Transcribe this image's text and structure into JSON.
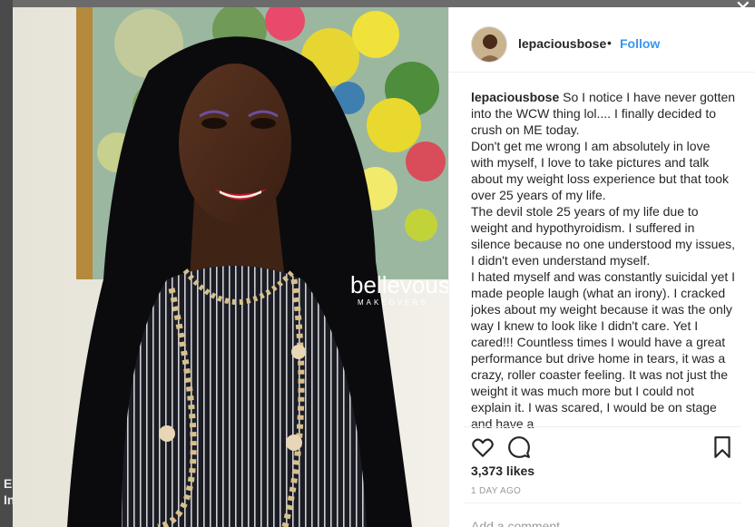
{
  "post": {
    "username": "lepaciousbose",
    "separator": "•",
    "follow_label": "Follow",
    "caption_user": "lepaciousbose",
    "caption_paragraphs": [
      "So I notice I have never gotten into the WCW thing lol.... I finally decided to crush on ME today.",
      "Don't get me wrong I am absolutely in love with myself, I love to take pictures and talk about my weight loss experience but that took over 25 years of my life.",
      "The devil stole 25 years of my life due to weight and hypothyroidism. I suffered in silence because no one understood my issues, I didn't even understand myself.",
      "I hated myself and was constantly suicidal yet I made people laugh (what an irony). I cracked jokes about my weight because it was the only way I knew to look like I didn't care. Yet I cared!!! Countless times I would have a great performance but drive home in tears, it was a crazy, roller coaster feeling. It was not just the weight it was much more but I could not explain it. I was scared, I would be on stage and have a"
    ],
    "likes": "3,373 likes",
    "age": "1 DAY AGO",
    "add_comment_placeholder": "Add a comment..."
  },
  "photo": {
    "watermark": "bellevous",
    "watermark_sub": "MAKEOVERS"
  },
  "background": {
    "partial_text": "E In"
  },
  "icons": [
    "heart-icon",
    "comment-icon",
    "bookmark-icon",
    "close-icon"
  ],
  "colors": {
    "accent": "#3897f0",
    "text": "#262626",
    "muted": "#999999"
  }
}
